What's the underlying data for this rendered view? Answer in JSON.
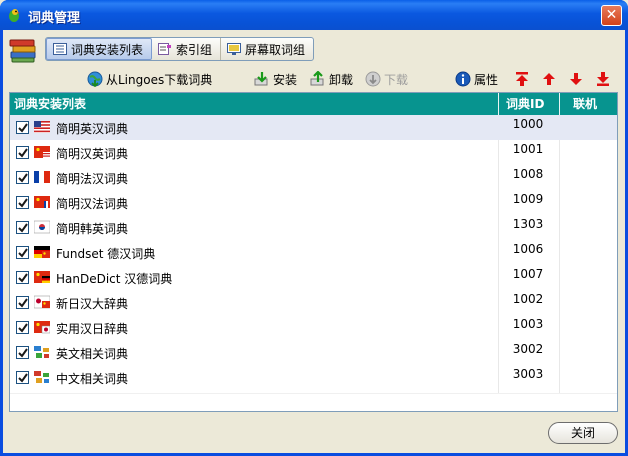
{
  "window": {
    "title": "词典管理",
    "close_glyph": "✕"
  },
  "tabs": [
    {
      "label": "词典安装列表",
      "icon": "list-icon",
      "active": true
    },
    {
      "label": "索引组",
      "icon": "index-group-icon",
      "active": false
    },
    {
      "label": "屏幕取词组",
      "icon": "screen-capture-icon",
      "active": false
    }
  ],
  "actions": {
    "download_from": "从Lingoes下载词典",
    "install": "安装",
    "uninstall": "卸载",
    "download": "下载",
    "properties": "属性"
  },
  "list": {
    "columns": {
      "name": "词典安装列表",
      "id": "词典ID",
      "online": "联机"
    },
    "rows": [
      {
        "name": "简明英汉词典",
        "id": "1000",
        "flag": "us-flag",
        "checked": true
      },
      {
        "name": "简明汉英词典",
        "id": "1001",
        "flag": "cn-us-flag",
        "checked": true
      },
      {
        "name": "简明法汉词典",
        "id": "1008",
        "flag": "fr-cn-flag",
        "checked": true
      },
      {
        "name": "简明汉法词典",
        "id": "1009",
        "flag": "cn-fr-flag",
        "checked": true
      },
      {
        "name": "简明韩英词典",
        "id": "1303",
        "flag": "kr-flag",
        "checked": true
      },
      {
        "name": "Fundset 德汉词典",
        "id": "1006",
        "flag": "de-cn-flag",
        "checked": true
      },
      {
        "name": "HanDeDict 汉德词典",
        "id": "1007",
        "flag": "cn-de-flag",
        "checked": true
      },
      {
        "name": "新日汉大辞典",
        "id": "1002",
        "flag": "jp-cn-flag",
        "checked": true
      },
      {
        "name": "实用汉日辞典",
        "id": "1003",
        "flag": "cn-jp-flag",
        "checked": true
      },
      {
        "name": "英文相关词典",
        "id": "3002",
        "flag": "related-en-icon",
        "checked": true
      },
      {
        "name": "中文相关词典",
        "id": "3003",
        "flag": "related-cn-icon",
        "checked": true
      }
    ]
  },
  "footer": {
    "close_label": "关闭"
  },
  "colors": {
    "header_bg": "#07948f",
    "arrow_red": "#e01010",
    "selected_row": "#e4e8f4"
  }
}
